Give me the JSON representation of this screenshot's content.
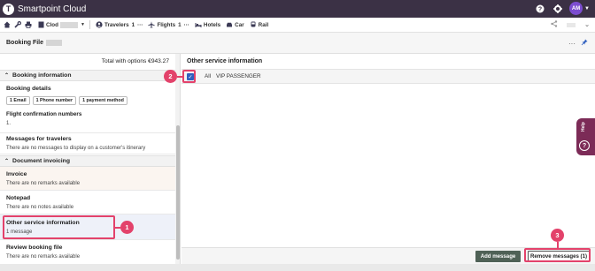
{
  "app": {
    "brand": "Smartpoint Cloud",
    "logo_letter": "T",
    "avatar_initials": "AM"
  },
  "nav": {
    "pcc_label": "Clod",
    "travelers_label": "Travelers",
    "travelers_count": "1",
    "travelers_more": "···",
    "flights_label": "Flights",
    "flights_count": "1",
    "flights_more": "···",
    "hotels_label": "Hotels",
    "car_label": "Car",
    "rail_label": "Rail"
  },
  "booking_file": {
    "title": "Booking File"
  },
  "left_panel": {
    "total_text": "Total with options €943.27",
    "section_booking_info": "Booking information",
    "booking_details_title": "Booking details",
    "chips": [
      "1 Email",
      "1 Phone number",
      "1 payment method"
    ],
    "flight_conf_title": "Flight confirmation numbers",
    "flight_conf_value": "1.",
    "messages_title": "Messages for travelers",
    "messages_sub": "There are no messages to display on a customer's itinerary",
    "section_doc_invoicing": "Document invoicing",
    "invoice_title": "Invoice",
    "invoice_sub": "There are no remarks available",
    "notepad_title": "Notepad",
    "notepad_sub": "There are no notes available",
    "osi_title": "Other service information",
    "osi_sub": "1 message",
    "review_title": "Review booking file",
    "review_sub": "There are no remarks available"
  },
  "right_panel": {
    "title": "Other service information",
    "row_all": "All",
    "row_value": "VIP PASSENGER",
    "checkbox_checked": true,
    "add_message": "Add message",
    "remove_messages": "Remove messages (1)"
  },
  "help": {
    "label": "Help",
    "q": "?"
  },
  "callouts": [
    "1",
    "2",
    "3"
  ],
  "colors": {
    "topbar": "#3b3145",
    "callout": "#e3426b",
    "add_button": "#4f6156",
    "help_tab": "#7c2b57",
    "checkbox": "#2f5fbf"
  }
}
